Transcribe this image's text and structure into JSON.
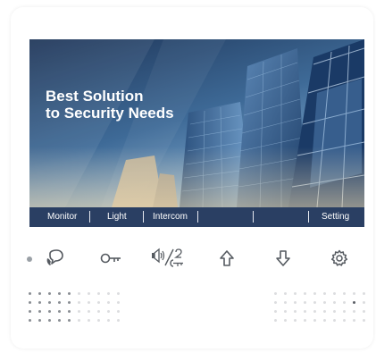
{
  "banner": {
    "headline_line1": "Best Solution",
    "headline_line2": "to Security Needs"
  },
  "menu": {
    "items": [
      {
        "label": "Monitor"
      },
      {
        "label": "Light"
      },
      {
        "label": "Intercom"
      },
      {
        "label": ""
      },
      {
        "label": ""
      },
      {
        "label": "Setting"
      }
    ]
  },
  "physical_buttons": [
    {
      "icon": "monitor-talk-icon"
    },
    {
      "icon": "key-unlock-icon"
    },
    {
      "icon": "volume-key2-icon"
    },
    {
      "icon": "arrow-up-icon"
    },
    {
      "icon": "arrow-down-icon"
    },
    {
      "icon": "gear-icon"
    }
  ],
  "colors": {
    "menu_bar": "#2a3f63",
    "sky_top": "#1e3558",
    "sky_bottom": "#7aa2c8",
    "icon": "#555a60",
    "led": "#9aa0a6"
  }
}
